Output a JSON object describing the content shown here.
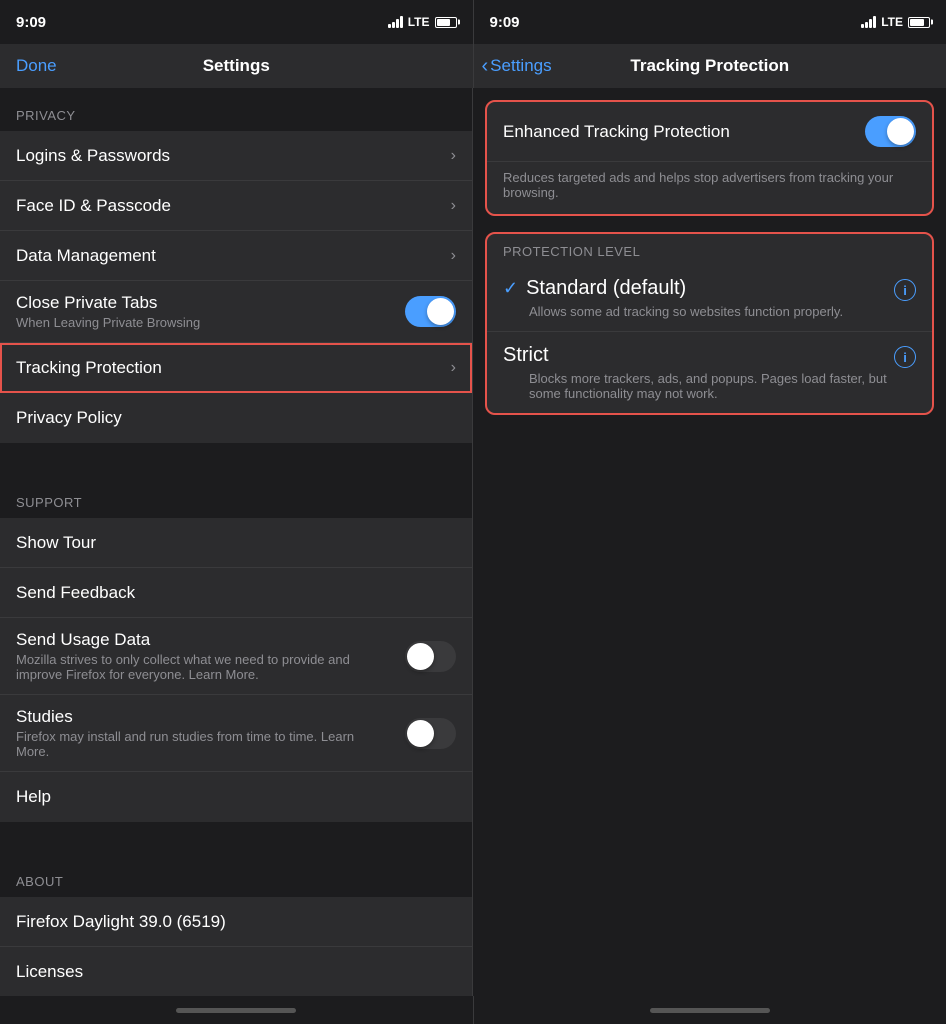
{
  "left_status": {
    "time": "9:09"
  },
  "right_status": {
    "time": "9:09"
  },
  "left_nav": {
    "title": "Settings",
    "done_label": "Done"
  },
  "right_nav": {
    "back_label": "Settings",
    "title": "Tracking Protection"
  },
  "left_panel": {
    "section_privacy": "PRIVACY",
    "section_support": "SUPPORT",
    "section_about": "ABOUT",
    "items_privacy": [
      {
        "id": "logins",
        "label": "Logins & Passwords",
        "type": "nav"
      },
      {
        "id": "faceid",
        "label": "Face ID & Passcode",
        "type": "nav"
      },
      {
        "id": "data",
        "label": "Data Management",
        "type": "nav"
      },
      {
        "id": "private-tabs",
        "label": "Close Private Tabs",
        "sublabel": "When Leaving Private Browsing",
        "type": "toggle",
        "value": "on"
      },
      {
        "id": "tracking",
        "label": "Tracking Protection",
        "type": "nav",
        "highlighted": true
      },
      {
        "id": "policy",
        "label": "Privacy Policy",
        "type": "plain"
      }
    ],
    "items_support": [
      {
        "id": "tour",
        "label": "Show Tour",
        "type": "plain"
      },
      {
        "id": "feedback",
        "label": "Send Feedback",
        "type": "plain"
      },
      {
        "id": "usage",
        "label": "Send Usage Data",
        "sublabel": "Mozilla strives to only collect what we need to provide and improve Firefox for everyone. Learn More.",
        "type": "toggle",
        "value": "off"
      },
      {
        "id": "studies",
        "label": "Studies",
        "sublabel": "Firefox may install and run studies from time to time. Learn More.",
        "type": "toggle",
        "value": "off"
      },
      {
        "id": "help",
        "label": "Help",
        "type": "plain"
      }
    ],
    "items_about": [
      {
        "id": "version",
        "label": "Firefox Daylight 39.0 (6519)",
        "type": "plain"
      },
      {
        "id": "licenses",
        "label": "Licenses",
        "type": "plain"
      }
    ]
  },
  "right_panel": {
    "etp_label": "Enhanced Tracking Protection",
    "etp_toggle": "on",
    "etp_desc": "Reduces targeted ads and helps stop advertisers from tracking your browsing.",
    "protection_level_header": "PROTECTION LEVEL",
    "options": [
      {
        "id": "standard",
        "title": "Standard (default)",
        "desc": "Allows some ad tracking so websites function properly.",
        "selected": true
      },
      {
        "id": "strict",
        "title": "Strict",
        "desc": "Blocks more trackers, ads, and popups. Pages load faster, but some functionality may not work.",
        "selected": false
      }
    ]
  }
}
